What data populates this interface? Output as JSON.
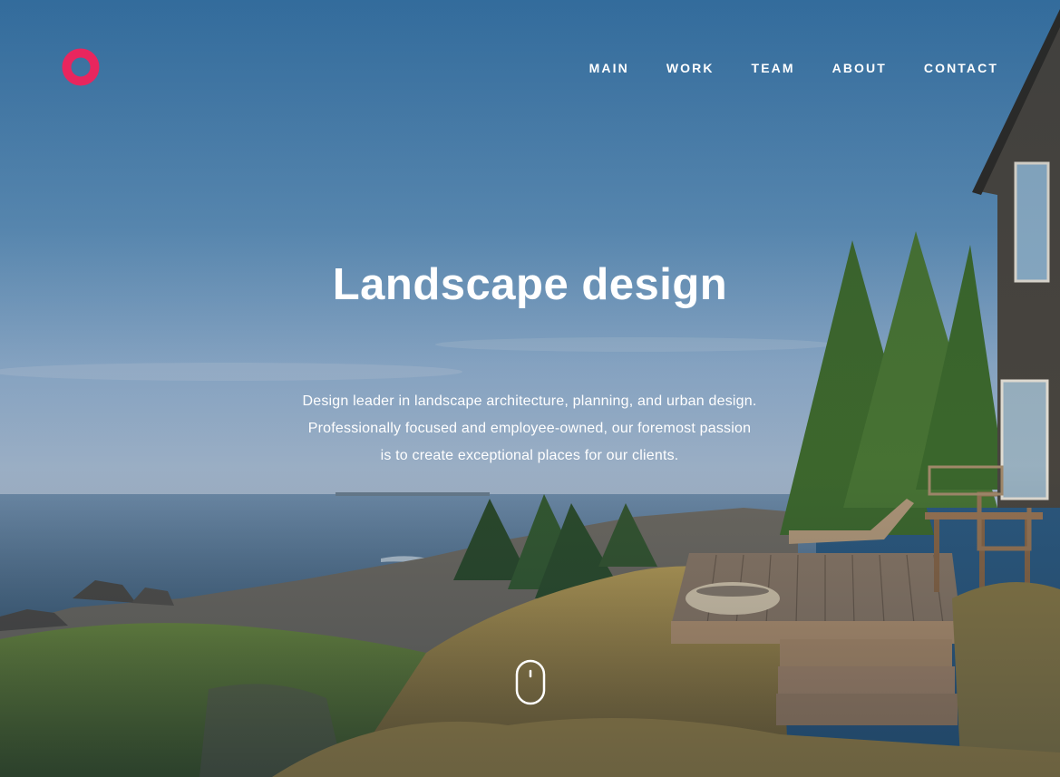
{
  "brand": {
    "logo_icon": "ring-logo-icon",
    "accent_color": "#e8265e"
  },
  "nav": {
    "items": [
      {
        "label": "MAIN"
      },
      {
        "label": "WORK"
      },
      {
        "label": "TEAM"
      },
      {
        "label": "ABOUT"
      },
      {
        "label": "CONTACT"
      }
    ]
  },
  "hero": {
    "title": "Landscape design",
    "description_lines": [
      "Design leader in landscape architecture, planning, and urban design.",
      "Professionally focused and employee-owned, our foremost passion",
      "is to create exceptional places for our clients."
    ],
    "scroll_icon": "mouse-scroll-icon",
    "background": "coastal landscape photo with house deck, pine trees and sea"
  }
}
